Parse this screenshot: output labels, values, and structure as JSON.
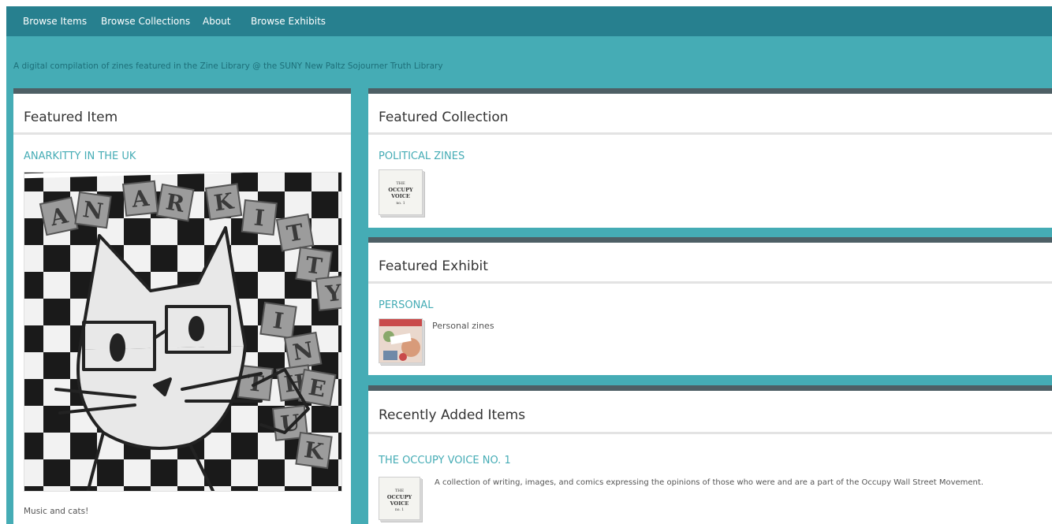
{
  "nav": {
    "items": [
      {
        "label": "Browse Items"
      },
      {
        "label": "Browse Collections"
      },
      {
        "label": "About"
      },
      {
        "label": "Browse Exhibits"
      }
    ]
  },
  "site": {
    "tagline": "A digital compilation of zines featured in the Zine Library @ the SUNY New Paltz Sojourner Truth Library"
  },
  "featured_item": {
    "heading": "Featured Item",
    "title": "ANARKITTY IN THE UK",
    "cover_letters": [
      "A",
      "N",
      "A",
      "R",
      "K",
      "I",
      "T",
      "T",
      "Y",
      "I",
      "N",
      "T",
      "H",
      "E",
      "U",
      "K"
    ],
    "caption": "Music and cats!"
  },
  "featured_collection": {
    "heading": "Featured Collection",
    "title": "POLITICAL ZINES",
    "thumb_text": {
      "small": "THE",
      "main": "OCCUPY VOICE",
      "issue": "no. 1"
    }
  },
  "featured_exhibit": {
    "heading": "Featured Exhibit",
    "title": "PERSONAL",
    "description": "Personal zines"
  },
  "recent_items": {
    "heading": "Recently Added Items",
    "items": [
      {
        "title": "THE OCCUPY VOICE NO. 1",
        "description": "A collection of writing, images, and comics expressing the opinions of those who were and are a part of the Occupy Wall Street Movement.",
        "thumb_text": {
          "small": "THE",
          "main": "OCCUPY VOICE",
          "issue": "no. 1"
        }
      }
    ]
  },
  "colors": {
    "background": "#45acb5",
    "nav_bar": "#27808f",
    "panel_border": "#4e5f65",
    "link": "#45acb5"
  }
}
